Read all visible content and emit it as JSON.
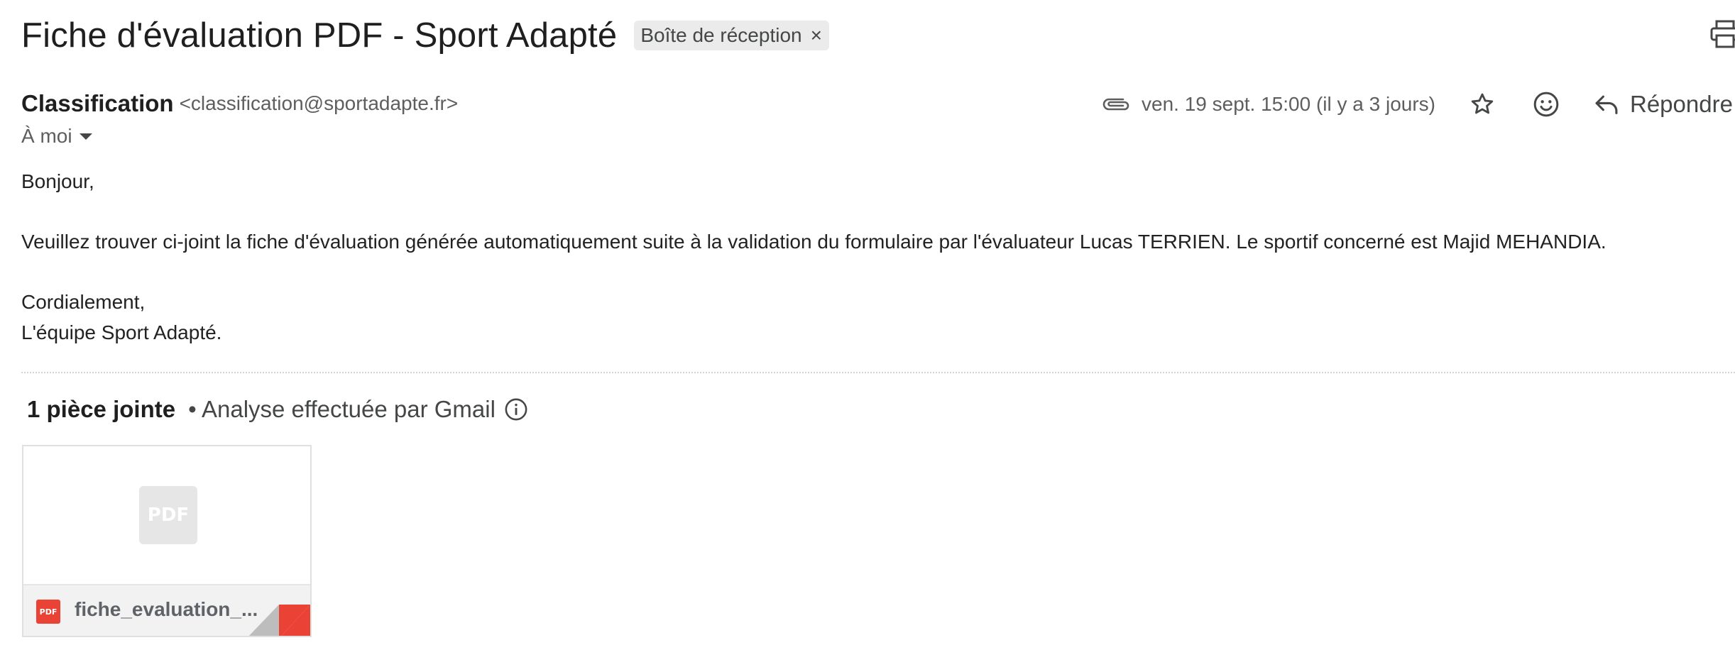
{
  "email": {
    "subject": "Fiche d'évaluation PDF - Sport Adapté",
    "label_chip": "Boîte de réception",
    "label_chip_close": "×",
    "sender": {
      "name": "Classification",
      "email": "<classification@sportadapte.fr>"
    },
    "recipient": "À moi",
    "date": "ven. 19 sept. 15:00 (il y a 3 jours)",
    "reply_label": "Répondre",
    "body": {
      "greeting": "Bonjour,",
      "paragraph": "Veuillez trouver ci-joint la fiche d'évaluation générée automatiquement suite à la validation du formulaire par l'évaluateur Lucas TERRIEN. Le sportif concerné est Majid MEHANDIA.",
      "closing": "Cordialement,",
      "signature": "L'équipe Sport Adapté."
    }
  },
  "attachments": {
    "count_label": "1 pièce jointe",
    "scan_label": "• Analyse effectuée par Gmail",
    "items": [
      {
        "name": "fiche_evaluation_...",
        "type_badge": "PDF",
        "preview_badge": "PDF"
      }
    ]
  },
  "icons": {
    "print": "print-icon",
    "attachment": "paperclip-icon",
    "star": "star-icon",
    "emoji": "emoji-icon",
    "reply": "reply-icon",
    "info": "info-icon",
    "dropdown": "caret-down-icon"
  },
  "colors": {
    "pdf_red": "#ea4335",
    "chip_bg": "#ebebeb",
    "muted_text": "#5e5e5e"
  }
}
